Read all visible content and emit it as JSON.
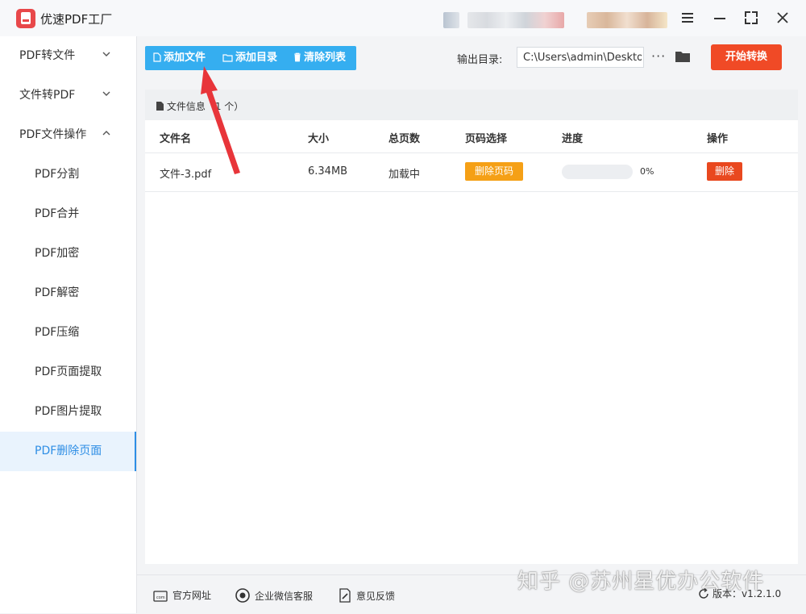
{
  "app": {
    "title": "优速PDF工厂"
  },
  "sidebar": {
    "items": [
      {
        "label": "PDF转文件",
        "expanded": false
      },
      {
        "label": "文件转PDF",
        "expanded": false
      },
      {
        "label": "PDF文件操作",
        "expanded": true
      }
    ],
    "sub_items": [
      {
        "label": "PDF分割"
      },
      {
        "label": "PDF合并"
      },
      {
        "label": "PDF加密"
      },
      {
        "label": "PDF解密"
      },
      {
        "label": "PDF压缩"
      },
      {
        "label": "PDF页面提取"
      },
      {
        "label": "PDF图片提取"
      },
      {
        "label": "PDF删除页面",
        "active": true
      }
    ]
  },
  "toolbar": {
    "add_file": "添加文件",
    "add_folder": "添加目录",
    "clear_list": "清除列表",
    "output_label": "输出目录:",
    "output_path": "C:\\Users\\admin\\Deskto",
    "more": "···",
    "start": "开始转换"
  },
  "file_list": {
    "info_label": "文件信息",
    "count_text": "（1 个）",
    "columns": [
      "文件名",
      "大小",
      "总页数",
      "页码选择",
      "进度",
      "操作"
    ],
    "rows": [
      {
        "name": "文件-3.pdf",
        "size": "6.34MB",
        "pages": "加载中",
        "page_select": "删除页码",
        "progress_text": "0%",
        "progress_value": 0,
        "action": "删除"
      }
    ]
  },
  "footer": {
    "website": "官方网址",
    "wechat": "企业微信客服",
    "feedback": "意见反馈",
    "version_label": "版本：",
    "version": "v1.2.1.0"
  },
  "watermark": "知乎 @苏州星优办公软件",
  "colors": {
    "accent_blue": "#35aef0",
    "start_red": "#f04a26",
    "delete_red": "#e9481f",
    "orange": "#f5a016",
    "arrow_red": "#e8353a"
  }
}
